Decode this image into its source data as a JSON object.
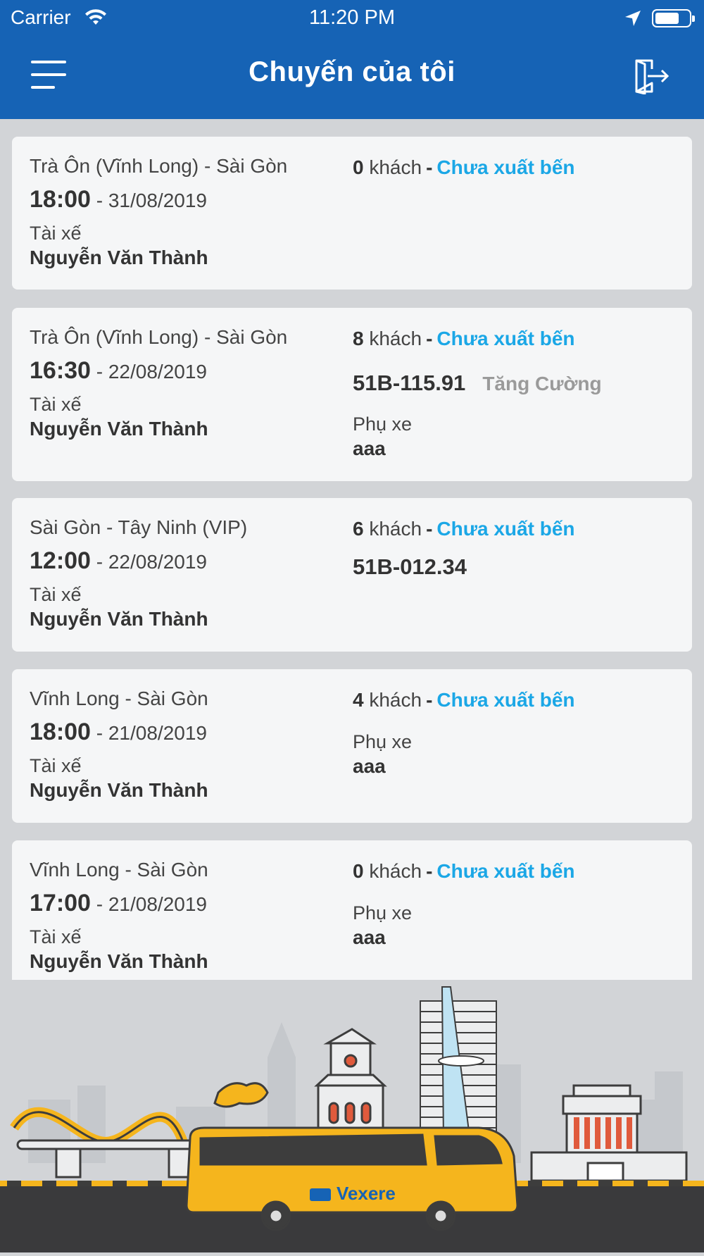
{
  "status_bar": {
    "carrier": "Carrier",
    "time": "11:20 PM"
  },
  "header": {
    "title": "Chuyến của tôi"
  },
  "colors": {
    "header_bg": "#1663b5",
    "status_accent": "#1ba7e6",
    "extra_tag": "#9a9a9a",
    "bus_yellow": "#f5b51d"
  },
  "trips": [
    {
      "route": "Trà Ôn (Vĩnh Long) - Sài Gòn",
      "time": "18:00",
      "date": "31/08/2019",
      "driver_label": "Tài xế",
      "driver": "Nguyễn Văn Thành",
      "passengers": "0",
      "passengers_unit": "khách",
      "status": "Chưa xuất bến"
    },
    {
      "route": "Trà Ôn (Vĩnh Long) - Sài Gòn",
      "time": "16:30",
      "date": "22/08/2019",
      "driver_label": "Tài xế",
      "driver": "Nguyễn Văn Thành",
      "passengers": "8",
      "passengers_unit": "khách",
      "status": "Chưa xuất bến",
      "plate": "51B-115.91",
      "extra": "Tăng Cường",
      "assistant_label": "Phụ xe",
      "assistant": "aaa"
    },
    {
      "route": "Sài Gòn - Tây Ninh (VIP)",
      "time": "12:00",
      "date": "22/08/2019",
      "driver_label": "Tài xế",
      "driver": "Nguyễn Văn Thành",
      "passengers": "6",
      "passengers_unit": "khách",
      "status": "Chưa xuất bến",
      "plate": "51B-012.34"
    },
    {
      "route": "Vĩnh Long - Sài Gòn",
      "time": "18:00",
      "date": "21/08/2019",
      "driver_label": "Tài xế",
      "driver": "Nguyễn Văn Thành",
      "passengers": "4",
      "passengers_unit": "khách",
      "status": "Chưa xuất bến",
      "assistant_label": "Phụ xe",
      "assistant": "aaa"
    },
    {
      "route": "Vĩnh Long - Sài Gòn",
      "time": "17:00",
      "date": "21/08/2019",
      "driver_label": "Tài xế",
      "driver": "Nguyễn Văn Thành",
      "passengers": "0",
      "passengers_unit": "khách",
      "status": "Chưa xuất bến",
      "assistant_label": "Phụ xe",
      "assistant": "aaa"
    }
  ],
  "branding": {
    "logo_text": "Vexere"
  }
}
